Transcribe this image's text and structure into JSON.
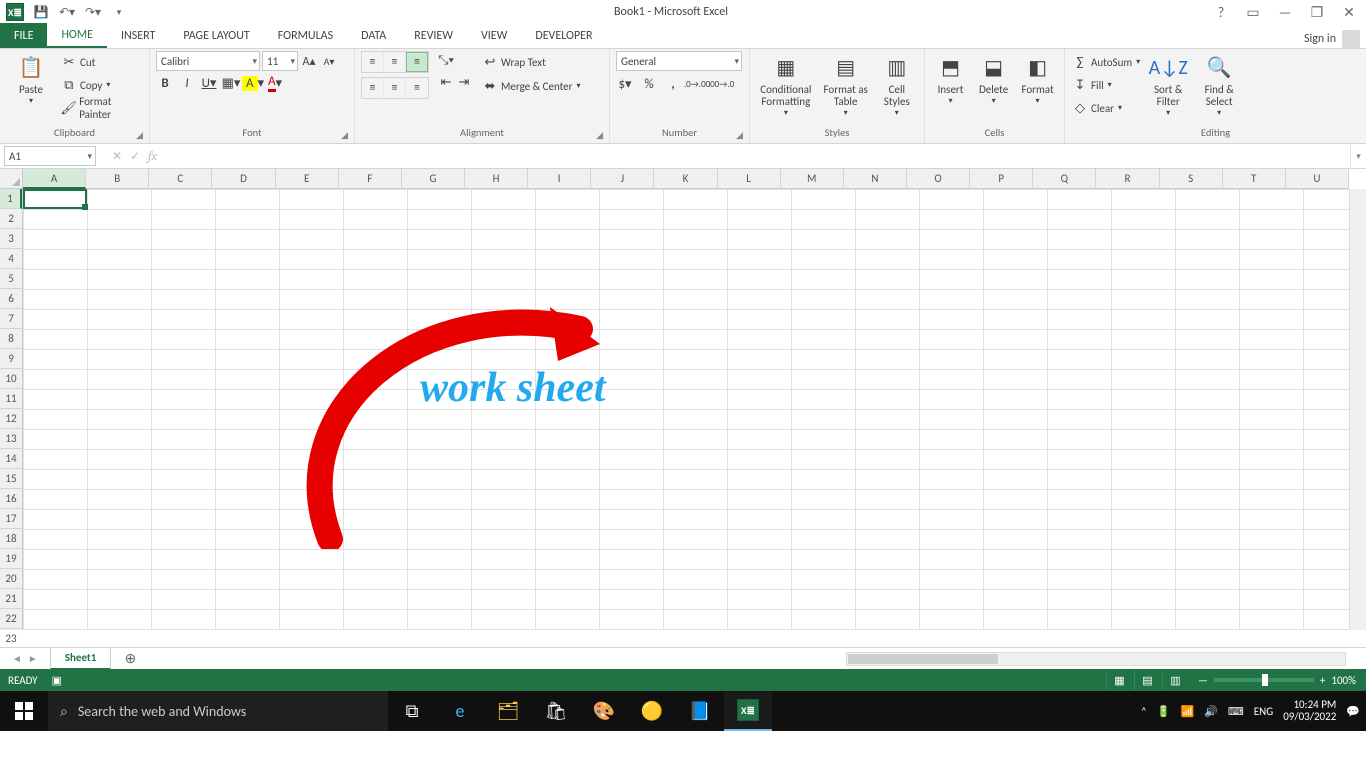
{
  "title": "Book1 - Microsoft Excel",
  "qat": {
    "save": "💾",
    "undo": "↺",
    "redo": "↻"
  },
  "win": {
    "help": "?",
    "ribbonopt": "▭",
    "min": "—",
    "restore": "❐",
    "close": "✕"
  },
  "tabs": {
    "file": "FILE",
    "items": [
      "HOME",
      "INSERT",
      "PAGE LAYOUT",
      "FORMULAS",
      "DATA",
      "REVIEW",
      "VIEW",
      "DEVELOPER"
    ],
    "active": "HOME",
    "signin": "Sign in"
  },
  "clipboard": {
    "paste": "Paste",
    "cut": "Cut",
    "copy": "Copy",
    "painter": "Format Painter",
    "group": "Clipboard"
  },
  "font": {
    "name": "Calibri",
    "size": "11",
    "group": "Font",
    "bold": "B",
    "italic": "I",
    "underline": "U"
  },
  "alignment": {
    "wrap": "Wrap Text",
    "merge": "Merge & Center",
    "group": "Alignment"
  },
  "number": {
    "format": "General",
    "group": "Number"
  },
  "styles": {
    "cond": "Conditional Formatting",
    "table": "Format as Table",
    "cell": "Cell Styles",
    "group": "Styles"
  },
  "cells": {
    "insert": "Insert",
    "delete": "Delete",
    "format": "Format",
    "group": "Cells"
  },
  "editing": {
    "sum": "AutoSum",
    "fill": "Fill",
    "clear": "Clear",
    "sort": "Sort & Filter",
    "find": "Find & Select",
    "group": "Editing"
  },
  "namebox": "A1",
  "columns": [
    "A",
    "B",
    "C",
    "D",
    "E",
    "F",
    "G",
    "H",
    "I",
    "J",
    "K",
    "L",
    "M",
    "N",
    "O",
    "P",
    "Q",
    "R",
    "S",
    "T",
    "U"
  ],
  "rows": 23,
  "annotation": "work sheet",
  "sheet": {
    "name": "Sheet1"
  },
  "status": {
    "ready": "READY",
    "zoom": "100%"
  },
  "taskbar": {
    "search": "Search the web and Windows",
    "lang": "ENG",
    "time": "10:24 PM",
    "date": "09/03/2022"
  }
}
